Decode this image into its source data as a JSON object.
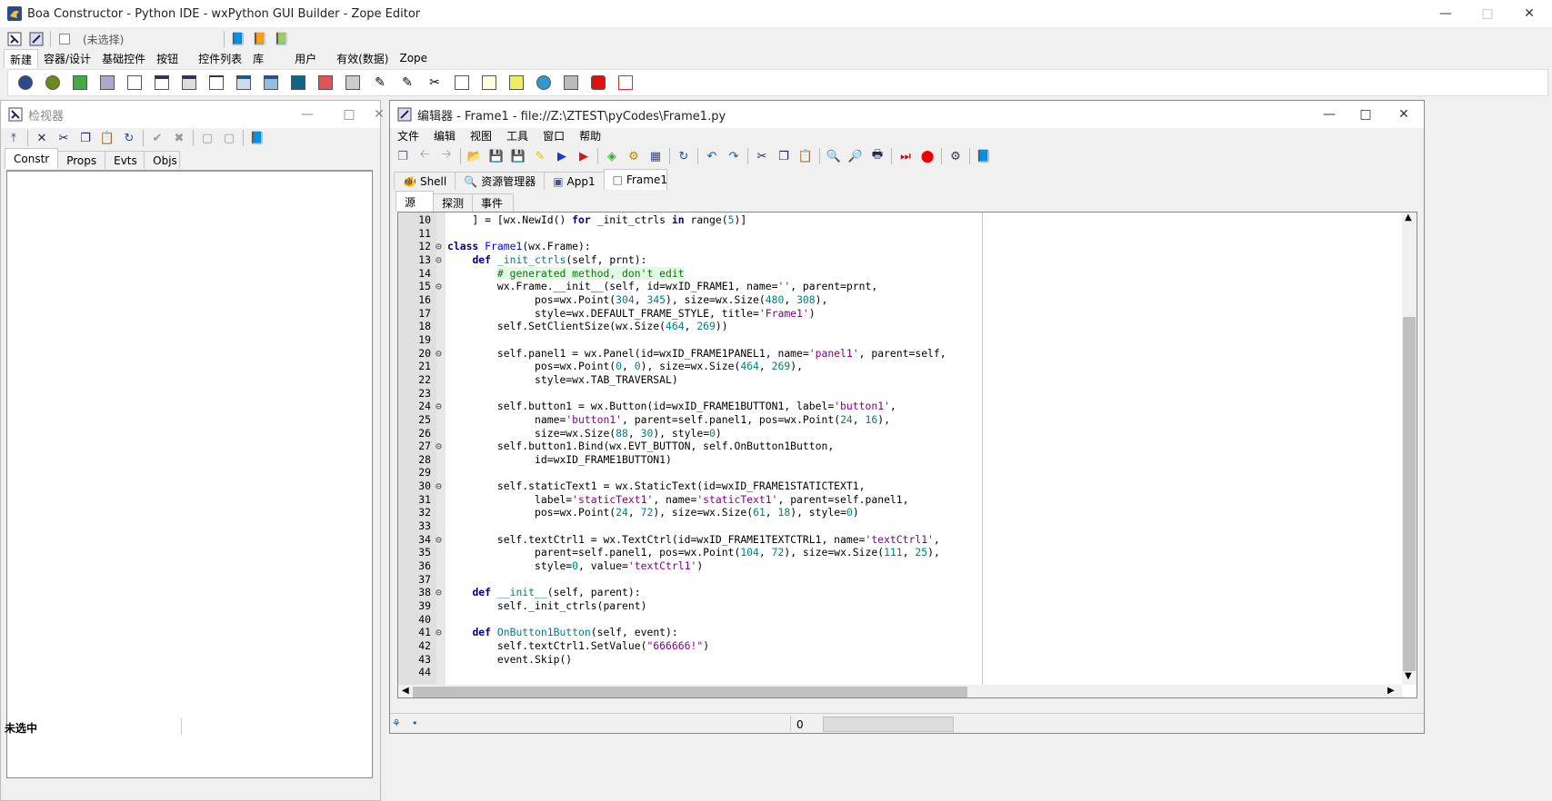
{
  "main_window": {
    "title": "Boa Constructor - Python IDE - wxPython GUI Builder - Zope Editor",
    "selection_label": "(未选择)",
    "palette_tabs": [
      "新建",
      "容器/设计",
      "基础控件",
      "按钮",
      "控件列表",
      "库",
      "用户",
      "有效(数据)",
      "Zope"
    ],
    "active_palette_tab": "新建"
  },
  "inspector": {
    "title": "检视器",
    "tabs": [
      "Constr",
      "Props",
      "Evts",
      "Objs"
    ],
    "status": "未选中"
  },
  "editor": {
    "title": "编辑器 - Frame1 - file://Z:\\ZTEST\\pyCodes\\Frame1.py",
    "menu": [
      "文件",
      "编辑",
      "视图",
      "工具",
      "窗口",
      "帮助"
    ],
    "file_tabs": [
      {
        "label": "Shell",
        "icon": "shell-icon"
      },
      {
        "label": "资源管理器",
        "icon": "explorer-icon"
      },
      {
        "label": "App1",
        "icon": "app-icon"
      },
      {
        "label": "Frame1",
        "icon": "frame-icon"
      }
    ],
    "view_tabs": [
      "源",
      "探测",
      "事件"
    ],
    "status_position": "0",
    "code_lines": [
      {
        "n": "10",
        "t": "    ] = [wx.NewId() for _init_ctrls in range(5)]"
      },
      {
        "n": "11",
        "t": ""
      },
      {
        "n": "12",
        "t": "class Frame1(wx.Frame):"
      },
      {
        "n": "13",
        "t": "    def _init_ctrls(self, prnt):"
      },
      {
        "n": "14",
        "t": "        # generated method, don't edit"
      },
      {
        "n": "15",
        "t": "        wx.Frame.__init__(self, id=wxID_FRAME1, name='', parent=prnt,"
      },
      {
        "n": "16",
        "t": "              pos=wx.Point(304, 345), size=wx.Size(480, 308),"
      },
      {
        "n": "17",
        "t": "              style=wx.DEFAULT_FRAME_STYLE, title='Frame1')"
      },
      {
        "n": "18",
        "t": "        self.SetClientSize(wx.Size(464, 269))"
      },
      {
        "n": "19",
        "t": ""
      },
      {
        "n": "20",
        "t": "        self.panel1 = wx.Panel(id=wxID_FRAME1PANEL1, name='panel1', parent=self,"
      },
      {
        "n": "21",
        "t": "              pos=wx.Point(0, 0), size=wx.Size(464, 269),"
      },
      {
        "n": "22",
        "t": "              style=wx.TAB_TRAVERSAL)"
      },
      {
        "n": "23",
        "t": ""
      },
      {
        "n": "24",
        "t": "        self.button1 = wx.Button(id=wxID_FRAME1BUTTON1, label='button1',"
      },
      {
        "n": "25",
        "t": "              name='button1', parent=self.panel1, pos=wx.Point(24, 16),"
      },
      {
        "n": "26",
        "t": "              size=wx.Size(88, 30), style=0)"
      },
      {
        "n": "27",
        "t": "        self.button1.Bind(wx.EVT_BUTTON, self.OnButton1Button,"
      },
      {
        "n": "28",
        "t": "              id=wxID_FRAME1BUTTON1)"
      },
      {
        "n": "29",
        "t": ""
      },
      {
        "n": "30",
        "t": "        self.staticText1 = wx.StaticText(id=wxID_FRAME1STATICTEXT1,"
      },
      {
        "n": "31",
        "t": "              label='staticText1', name='staticText1', parent=self.panel1,"
      },
      {
        "n": "32",
        "t": "              pos=wx.Point(24, 72), size=wx.Size(61, 18), style=0)"
      },
      {
        "n": "33",
        "t": ""
      },
      {
        "n": "34",
        "t": "        self.textCtrl1 = wx.TextCtrl(id=wxID_FRAME1TEXTCTRL1, name='textCtrl1',"
      },
      {
        "n": "35",
        "t": "              parent=self.panel1, pos=wx.Point(104, 72), size=wx.Size(111, 25),"
      },
      {
        "n": "36",
        "t": "              style=0, value='textCtrl1')"
      },
      {
        "n": "37",
        "t": ""
      },
      {
        "n": "38",
        "t": "    def __init__(self, parent):"
      },
      {
        "n": "39",
        "t": "        self._init_ctrls(parent)"
      },
      {
        "n": "40",
        "t": ""
      },
      {
        "n": "41",
        "t": "    def OnButton1Button(self, event):"
      },
      {
        "n": "42",
        "t": "        self.textCtrl1.SetValue(\"666666!\")"
      },
      {
        "n": "43",
        "t": "        event.Skip()"
      },
      {
        "n": "44",
        "t": ""
      }
    ]
  },
  "colors": {
    "keyword": "#00007f",
    "function_name": "#007f7f",
    "string": "#7f007f",
    "number": "#007f7f",
    "comment": "#007f00",
    "gutter": "#e0e0e0"
  }
}
